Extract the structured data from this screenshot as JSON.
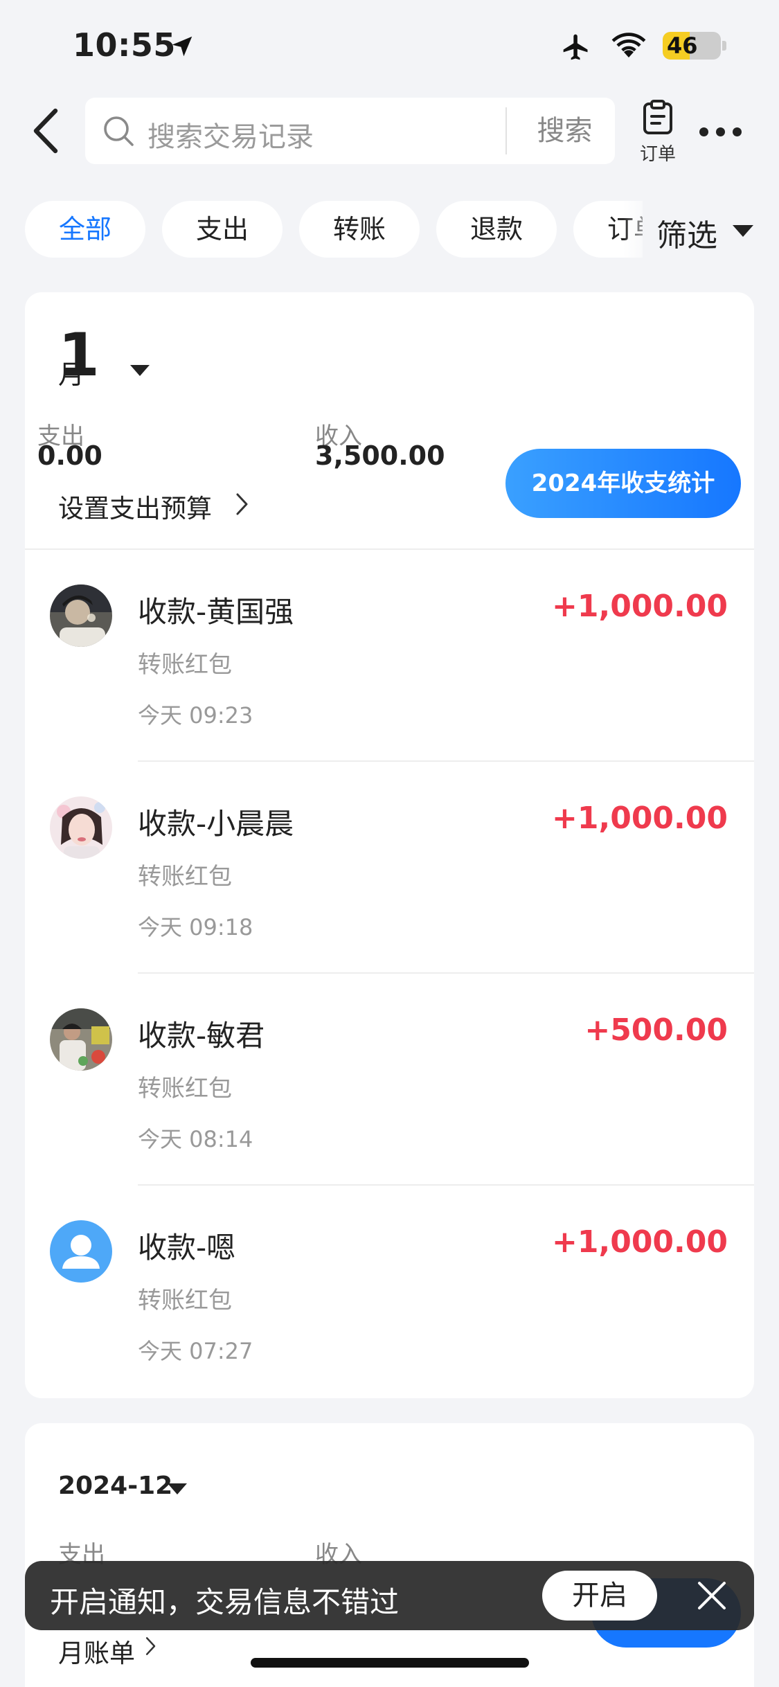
{
  "status_bar": {
    "time": "10:55",
    "battery": "46",
    "battery_level": 0.46,
    "location_icon": "location-arrow",
    "airplane_icon": "airplane",
    "wifi_icon": "wifi"
  },
  "nav": {
    "back_icon": "chevron-left",
    "search_placeholder": "搜索交易记录",
    "search_button": "搜索",
    "orders_label": "订单",
    "more_icon": "ellipsis"
  },
  "filters": {
    "chips": [
      "全部",
      "支出",
      "转账",
      "退款",
      "订单"
    ],
    "active": "全部",
    "filter_label": "筛选"
  },
  "current_month": {
    "month": "1",
    "unit": "月",
    "expense_label": "支出",
    "expense_value": "0.00",
    "income_label": "收入",
    "income_value": "3,500.00",
    "budget_link": "设置支出预算",
    "stats_button": "2024年收支统计"
  },
  "transactions": [
    {
      "title": "收款-黄国强",
      "amount": "+1,000.00",
      "type": "转账红包",
      "time": "今天 09:23",
      "avatar": "photo-avatar"
    },
    {
      "title": "收款-小晨晨",
      "amount": "+1,000.00",
      "type": "转账红包",
      "time": "今天 09:18",
      "avatar": "photo-avatar"
    },
    {
      "title": "收款-敏君",
      "amount": "+500.00",
      "type": "转账红包",
      "time": "今天 08:14",
      "avatar": "photo-avatar"
    },
    {
      "title": "收款-嗯",
      "amount": "+1,000.00",
      "type": "转账红包",
      "time": "今天 07:27",
      "avatar": "default-user-avatar"
    }
  ],
  "previous_month": {
    "period": "2024-12",
    "expense_label": "支出",
    "income_label": "收入",
    "bill_link": "月账单"
  },
  "toast": {
    "text": "开启通知，交易信息不错过",
    "button": "开启",
    "close_icon": "close"
  },
  "colors": {
    "accent": "#1677ff",
    "income": "#ef3a4d",
    "background": "#f3f4f7"
  }
}
